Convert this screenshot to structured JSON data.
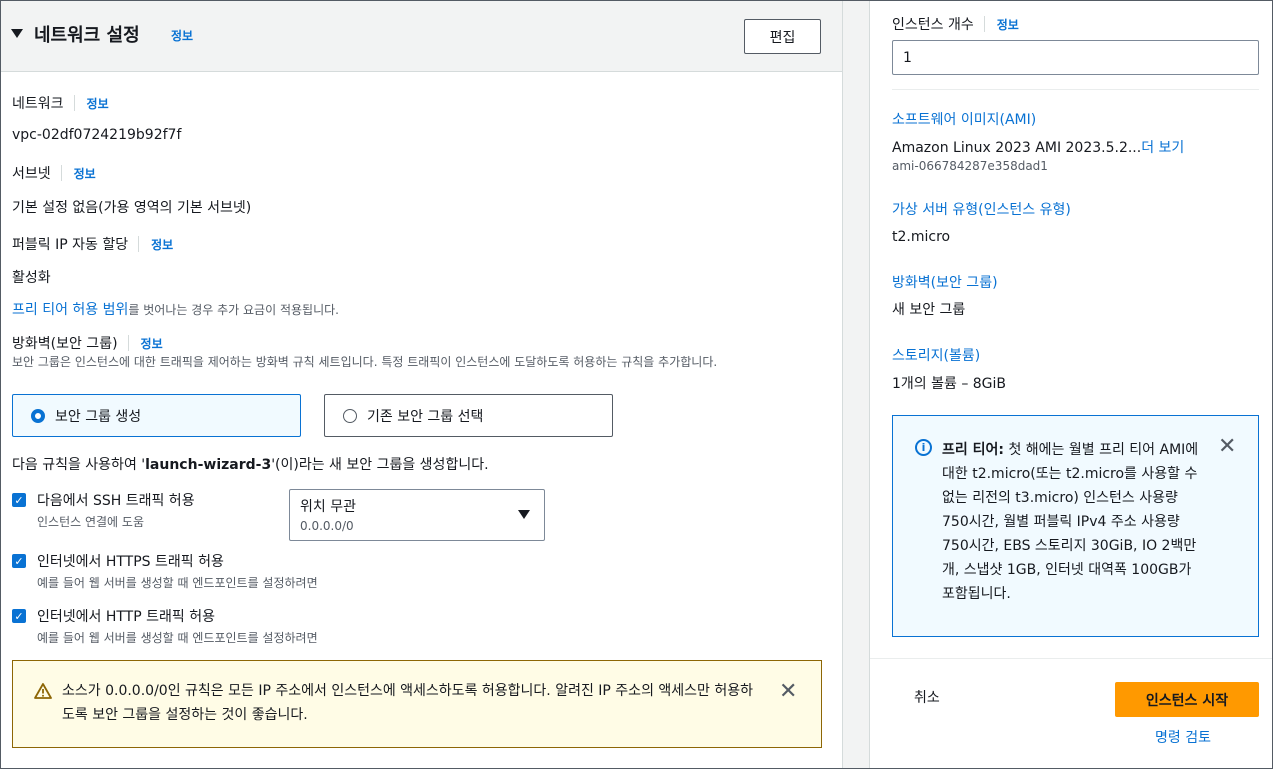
{
  "network_settings": {
    "title": "네트워크 설정",
    "info": "정보",
    "edit_label": "편집",
    "network_label": "네트워크",
    "network_info": "정보",
    "network_value": "vpc-02df0724219b92f7f",
    "subnet_label": "서브넷",
    "subnet_info": "정보",
    "subnet_value": "기본 설정 없음(가용 영역의 기본 서브넷)",
    "public_ip_label": "퍼블릭 IP 자동 할당",
    "public_ip_info": "정보",
    "public_ip_value": "활성화",
    "free_tier_link": "프리 티어 허용 범위",
    "free_tier_note": "를 벗어나는 경우 추가 요금이 적용됩니다.",
    "firewall_label": "방화벽(보안 그룹)",
    "firewall_info": "정보",
    "firewall_desc": "보안 그룹은 인스턴스에 대한 트래픽을 제어하는 방화벽 규칙 세트입니다. 특정 트래픽이 인스턴스에 도달하도록 허용하는 규칙을 추가합니다.",
    "sg_option_create": "보안 그룹 생성",
    "sg_option_existing": "기존 보안 그룹 선택",
    "rule_note_prefix": "다음 규칙을 사용하여 '",
    "rule_note_name": "launch-wizard-3",
    "rule_note_suffix": "'(이)라는 새 보안 그룹을 생성합니다.",
    "rules": [
      {
        "label": "다음에서 SSH 트래픽 허용",
        "desc": "인스턴스 연결에 도움",
        "checked": true
      },
      {
        "label": "인터넷에서 HTTPS 트래픽 허용",
        "desc": "예를 들어 웹 서버를 생성할 때 엔드포인트를 설정하려면",
        "checked": true
      },
      {
        "label": "인터넷에서 HTTP 트래픽 허용",
        "desc": "예를 들어 웹 서버를 생성할 때 엔드포인트를 설정하려면",
        "checked": true
      }
    ],
    "ssh_source_value": "위치 무관",
    "ssh_source_sub": "0.0.0.0/0",
    "warning_text": "소스가 0.0.0.0/0인 규칙은 모든 IP 주소에서 인스턴스에 액세스하도록 허용합니다. 알려진 IP 주소의 액세스만 허용하도록 보안 그룹을 설정하는 것이 좋습니다."
  },
  "summary": {
    "instance_count_label": "인스턴스 개수",
    "instance_count_info": "정보",
    "instance_count_value": "1",
    "ami_label": "소프트웨어 이미지(AMI)",
    "ami_value": "Amazon Linux 2023 AMI 2023.5.2...",
    "ami_more": "더 보기",
    "ami_id": "ami-066784287e358dad1",
    "instance_type_label": "가상 서버 유형(인스턴스 유형)",
    "instance_type_value": "t2.micro",
    "firewall_label": "방화벽(보안 그룹)",
    "firewall_value": "새 보안 그룹",
    "storage_label": "스토리지(볼륨)",
    "storage_value": "1개의 볼륨 – 8GiB",
    "free_tier_title": "프리 티어:",
    "free_tier_text": " 첫 해에는 월별 프리 티어 AMI에 대한 t2.micro(또는 t2.micro를 사용할 수 없는 리전의 t3.micro) 인스턴스 사용량 750시간, 월별 퍼블릭 IPv4 주소 사용량 750시간, EBS 스토리지 30GiB, IO 2백만 개, 스냅샷 1GB, 인터넷 대역폭 100GB가 포함됩니다.",
    "cancel_label": "취소",
    "launch_label": "인스턴스 시작",
    "review_label": "명령 검토"
  },
  "colors": {
    "link": "#0972d3",
    "primary_button": "#ff9900",
    "warning_bg": "#fffce6",
    "info_bg": "#f1faff"
  }
}
